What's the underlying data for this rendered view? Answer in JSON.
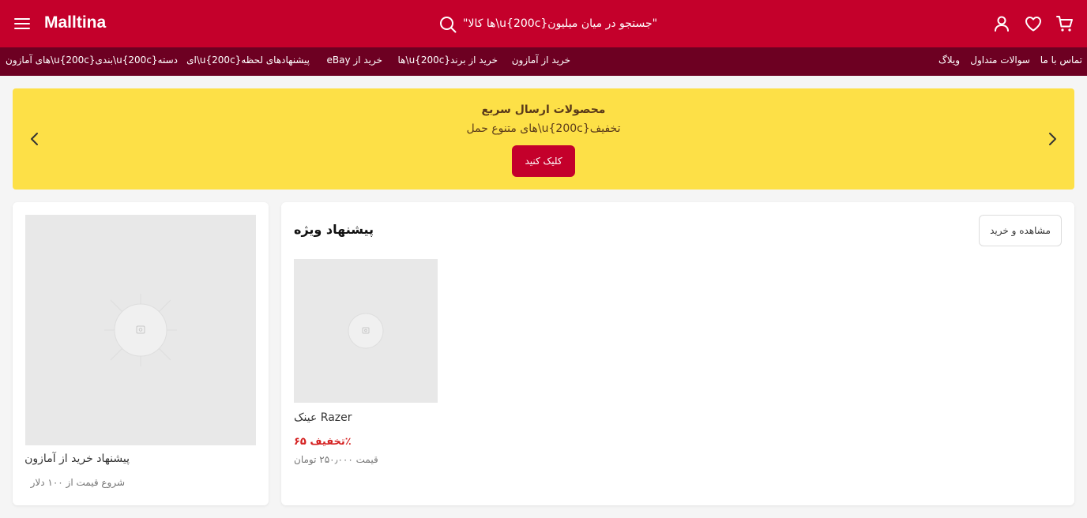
{
  "header": {
    "logo": "Malltina",
    "search_placeholder": "\"ها کالا\\u{200c}جستجو در میان میلیون\"",
    "icons": [
      "menu-icon",
      "search-icon",
      "user-icon",
      "heart-icon",
      "cart-icon"
    ],
    "bg_color": "#c4002b"
  },
  "subnav": {
    "right_items": [
      "تماس با ما",
      "سوالات متداول",
      "ویلاگ"
    ],
    "left_items": [
      "خرید از آمازون",
      "ها\\u{200c}خرید از برند",
      "eBay خرید از",
      "ای\\u{200c}پیشنهادهای لحظه",
      "های آمازون\\u{200c}بندی\\u{200c}دسته"
    ],
    "bg_color": "#6d0022"
  },
  "banner": {
    "title": "محصولات ارسال سریع",
    "subtitle": "های متنوع حمل\\u{200c}تخفیف",
    "button_label": "کلیک کنید",
    "bg_color": "#fde047"
  },
  "promo_card": {
    "title": "پیشنهاد خرید از آمازون",
    "subtitle": "شروع قیمت از ۱۰۰ دلار"
  },
  "special_offer": {
    "title": "پیشنهاد ویژه",
    "view_button": "مشاهده و خرید",
    "products": [
      {
        "name": "عینک Razer",
        "discount": "تخفیف ۶۵٪",
        "price": "قیمت ۲۵۰٫۰۰۰ تومان"
      }
    ]
  }
}
